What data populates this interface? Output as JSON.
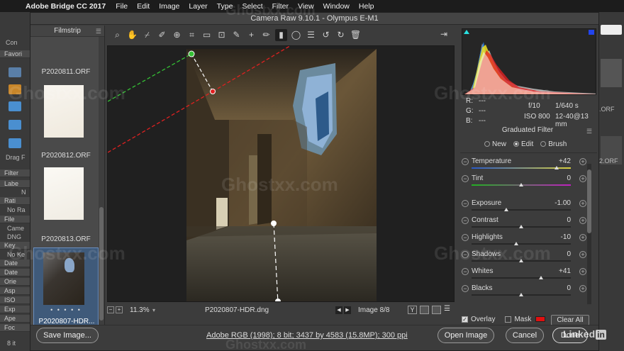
{
  "menubar": {
    "app_name": "Adobe Bridge CC 2017",
    "items": [
      "File",
      "Edit",
      "Image",
      "Layer",
      "Type",
      "Select",
      "Filter",
      "View",
      "Window",
      "Help"
    ]
  },
  "bridge_bg": {
    "left_labels": [
      "Con",
      "Favori",
      "Drag F",
      "Filter",
      "Labe",
      "N",
      "Rati",
      "No Ra",
      "File",
      "Came",
      "DNG",
      "Key",
      "No Ke",
      "Date",
      "Date",
      "Orie",
      "Asp",
      "ISO",
      "Exp",
      "Ape",
      "Foc",
      "8 it"
    ],
    "right_labels": [
      ".ORF",
      "2.ORF"
    ]
  },
  "window": {
    "title": "Camera Raw 9.10.1  -  Olympus E-M1"
  },
  "filmstrip": {
    "header": "Filmstrip",
    "items": [
      {
        "label": "P2020811.ORF"
      },
      {
        "label": "P2020812.ORF"
      },
      {
        "label": "P2020813.ORF"
      },
      {
        "label": "P2020807-HDR...",
        "selected": true,
        "rating_dots": "• • • • •"
      }
    ]
  },
  "preview_bar": {
    "zoom": "11.3%",
    "filename": "P2020807-HDR.dng",
    "image_counter": "Image 8/8",
    "view_y": "Y",
    "prev": "◀",
    "next": "▶"
  },
  "readouts": {
    "r_label": "R:",
    "g_label": "G:",
    "b_label": "B:",
    "r": "---",
    "g": "---",
    "b": "---",
    "aperture": "f/10",
    "shutter": "1/640 s",
    "iso": "ISO 800",
    "lens": "12-40@13 mm"
  },
  "panel": {
    "title": "Graduated Filter",
    "modes": [
      {
        "label": "New",
        "selected": false
      },
      {
        "label": "Edit",
        "selected": true
      },
      {
        "label": "Brush",
        "selected": false
      }
    ],
    "sliders": [
      {
        "label": "Temperature",
        "value": "+42",
        "pos": 0.86,
        "track": "temp"
      },
      {
        "label": "Tint",
        "value": "0",
        "pos": 0.5,
        "track": "tint"
      },
      {
        "label": "Exposure",
        "value": "-1.00",
        "pos": 0.35,
        "track": "plain"
      },
      {
        "label": "Contrast",
        "value": "0",
        "pos": 0.5,
        "track": "plain"
      },
      {
        "label": "Highlights",
        "value": "-10",
        "pos": 0.45,
        "track": "plain"
      },
      {
        "label": "Shadows",
        "value": "0",
        "pos": 0.5,
        "track": "plain"
      },
      {
        "label": "Whites",
        "value": "+41",
        "pos": 0.7,
        "track": "plain"
      },
      {
        "label": "Blacks",
        "value": "0",
        "pos": 0.5,
        "track": "plain"
      }
    ],
    "overlay_label": "Overlay",
    "overlay_checked": true,
    "mask_label": "Mask",
    "mask_checked": false,
    "mask_color": "#e01010",
    "clear_all": "Clear All"
  },
  "bottom": {
    "save_image": "Save Image...",
    "workflow": "Adobe RGB (1998); 8 bit; 3437 by 4583 (15.8MP); 300 ppi",
    "open_image": "Open Image",
    "cancel": "Cancel",
    "done": "Done"
  },
  "watermark": {
    "text": "Ghostxx.com",
    "brand": "Linked",
    "brand_in": "in"
  },
  "icons": {
    "toolbar": [
      "zoom-icon",
      "hand-icon",
      "white-balance-icon",
      "color-sampler-icon",
      "targeted-adjustment-icon",
      "crop-icon",
      "straighten-icon",
      "transform-icon",
      "spot-removal-icon",
      "red-eye-icon",
      "adjustment-brush-icon",
      "graduated-filter-icon",
      "radial-filter-icon",
      "preferences-icon",
      "rotate-ccw-icon",
      "rotate-cw-icon",
      "trash-icon"
    ]
  },
  "colors": {
    "accent": "#6b8fbf",
    "gradient_green": "#36c236",
    "gradient_red": "#e02020"
  }
}
